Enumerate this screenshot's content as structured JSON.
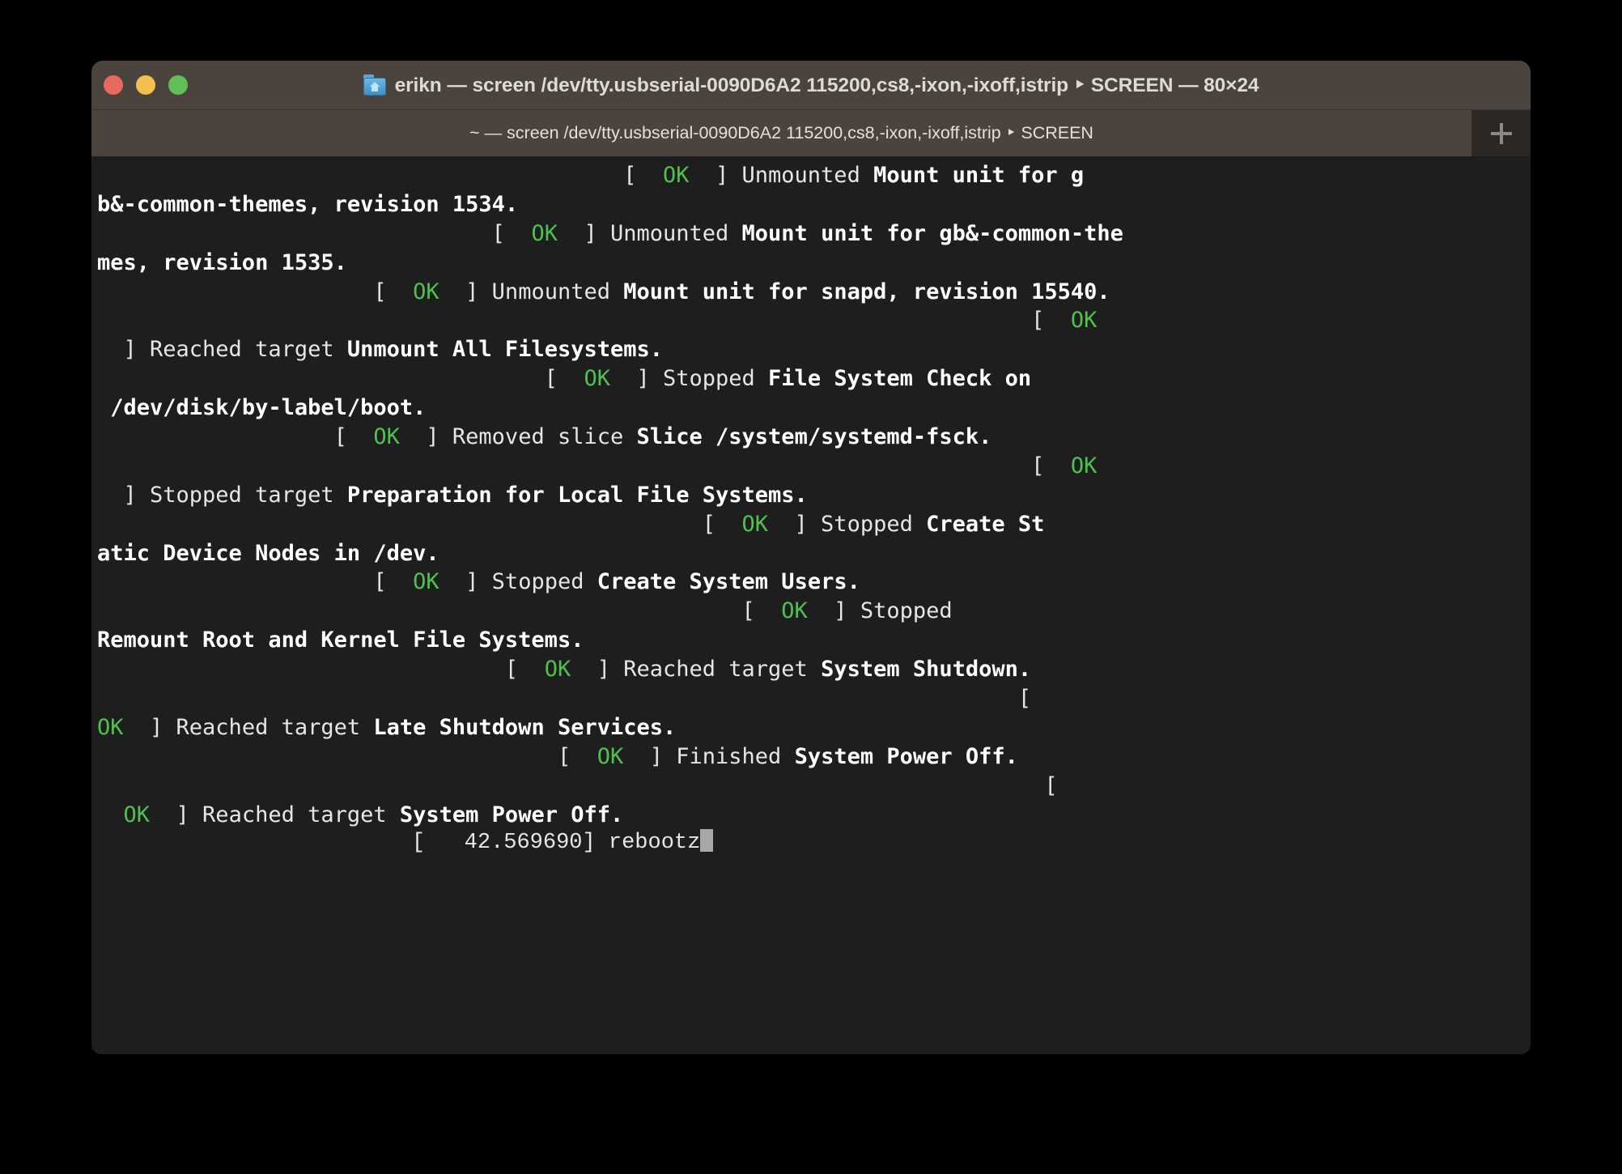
{
  "window": {
    "title": "erikn — screen /dev/tty.usbserial-0090D6A2 115200,cs8,-ixon,-ixoff,istrip ‣ SCREEN — 80×24",
    "folder_icon": "home-folder-icon",
    "traffic_lights": {
      "close_color": "#e8695e",
      "minimize_color": "#f3bf4f",
      "zoom_color": "#5fc056"
    }
  },
  "tabbar": {
    "tab_label": "~ — screen /dev/tty.usbserial-0090D6A2 115200,cs8,-ixon,-ixoff,istrip ‣ SCREEN",
    "new_tab_label": "+"
  },
  "terminal": {
    "background": "#1e1e1e",
    "foreground": "#e6e6e6",
    "ok_color": "#4fc14f",
    "cursor_color": "#a8a8a8",
    "columns": 80,
    "rows": 24,
    "lines": [
      {
        "segments": [
          {
            "text": "                                        [  ",
            "style": "plain"
          },
          {
            "text": "OK",
            "style": "ok"
          },
          {
            "text": "  ] Unmounted ",
            "style": "plain"
          },
          {
            "text": "Mount unit for g",
            "style": "bold"
          }
        ]
      },
      {
        "segments": [
          {
            "text": "b&-common-themes, revision 1534.",
            "style": "bold"
          }
        ]
      },
      {
        "segments": [
          {
            "text": "                              [  ",
            "style": "plain"
          },
          {
            "text": "OK",
            "style": "ok"
          },
          {
            "text": "  ] Unmounted ",
            "style": "plain"
          },
          {
            "text": "Mount unit for gb&-common-the",
            "style": "bold"
          }
        ]
      },
      {
        "segments": [
          {
            "text": "mes, revision 1535.",
            "style": "bold"
          }
        ]
      },
      {
        "segments": [
          {
            "text": "                     [  ",
            "style": "plain"
          },
          {
            "text": "OK",
            "style": "ok"
          },
          {
            "text": "  ] Unmounted ",
            "style": "plain"
          },
          {
            "text": "Mount unit for snapd, revision 15540.",
            "style": "bold"
          }
        ]
      },
      {
        "segments": [
          {
            "text": "                                                                       [  ",
            "style": "plain"
          },
          {
            "text": "OK",
            "style": "ok"
          }
        ]
      },
      {
        "segments": [
          {
            "text": "  ] Reached target ",
            "style": "plain"
          },
          {
            "text": "Unmount All Filesystems.",
            "style": "bold"
          }
        ]
      },
      {
        "segments": [
          {
            "text": "                                  [  ",
            "style": "plain"
          },
          {
            "text": "OK",
            "style": "ok"
          },
          {
            "text": "  ] Stopped ",
            "style": "plain"
          },
          {
            "text": "File System Check on",
            "style": "bold"
          }
        ]
      },
      {
        "segments": [
          {
            "text": " ",
            "style": "plain"
          },
          {
            "text": "/dev/disk/by-label/boot.",
            "style": "bold"
          }
        ]
      },
      {
        "segments": [
          {
            "text": "                  [  ",
            "style": "plain"
          },
          {
            "text": "OK",
            "style": "ok"
          },
          {
            "text": "  ] Removed slice ",
            "style": "plain"
          },
          {
            "text": "Slice /system/systemd-fsck.",
            "style": "bold"
          }
        ]
      },
      {
        "segments": [
          {
            "text": "                                                                       [  ",
            "style": "plain"
          },
          {
            "text": "OK",
            "style": "ok"
          }
        ]
      },
      {
        "segments": [
          {
            "text": "  ] Stopped target ",
            "style": "plain"
          },
          {
            "text": "Preparation for Local File Systems.",
            "style": "bold"
          }
        ]
      },
      {
        "segments": [
          {
            "text": "                                              [  ",
            "style": "plain"
          },
          {
            "text": "OK",
            "style": "ok"
          },
          {
            "text": "  ] Stopped ",
            "style": "plain"
          },
          {
            "text": "Create St",
            "style": "bold"
          }
        ]
      },
      {
        "segments": [
          {
            "text": "atic Device Nodes in /dev.",
            "style": "bold"
          }
        ]
      },
      {
        "segments": [
          {
            "text": "                     [  ",
            "style": "plain"
          },
          {
            "text": "OK",
            "style": "ok"
          },
          {
            "text": "  ] Stopped ",
            "style": "plain"
          },
          {
            "text": "Create System Users.",
            "style": "bold"
          }
        ]
      },
      {
        "segments": [
          {
            "text": "                                                 [  ",
            "style": "plain"
          },
          {
            "text": "OK",
            "style": "ok"
          },
          {
            "text": "  ] Stopped",
            "style": "plain"
          }
        ]
      },
      {
        "segments": [
          {
            "text": "Remount Root and Kernel File Systems.",
            "style": "bold"
          }
        ]
      },
      {
        "segments": [
          {
            "text": "                               [  ",
            "style": "plain"
          },
          {
            "text": "OK",
            "style": "ok"
          },
          {
            "text": "  ] Reached target ",
            "style": "plain"
          },
          {
            "text": "System Shutdown.",
            "style": "bold"
          }
        ]
      },
      {
        "segments": [
          {
            "text": "                                                                      [",
            "style": "plain"
          }
        ]
      },
      {
        "segments": [
          {
            "text": "OK",
            "style": "ok"
          },
          {
            "text": "  ] Reached target ",
            "style": "plain"
          },
          {
            "text": "Late Shutdown Services.",
            "style": "bold"
          }
        ]
      },
      {
        "segments": [
          {
            "text": "                                   [  ",
            "style": "plain"
          },
          {
            "text": "OK",
            "style": "ok"
          },
          {
            "text": "  ] Finished ",
            "style": "plain"
          },
          {
            "text": "System Power Off.",
            "style": "bold"
          }
        ]
      },
      {
        "segments": [
          {
            "text": "                                                                        [",
            "style": "plain"
          }
        ]
      },
      {
        "segments": [
          {
            "text": "  ",
            "style": "plain"
          },
          {
            "text": "OK",
            "style": "ok"
          },
          {
            "text": "  ] Reached target ",
            "style": "plain"
          },
          {
            "text": "System Power Off.",
            "style": "bold"
          }
        ]
      },
      {
        "plain_font": true,
        "cursor": true,
        "segments": [
          {
            "text": "                        [   42.569690] rebootz",
            "style": "plain"
          }
        ]
      }
    ]
  }
}
